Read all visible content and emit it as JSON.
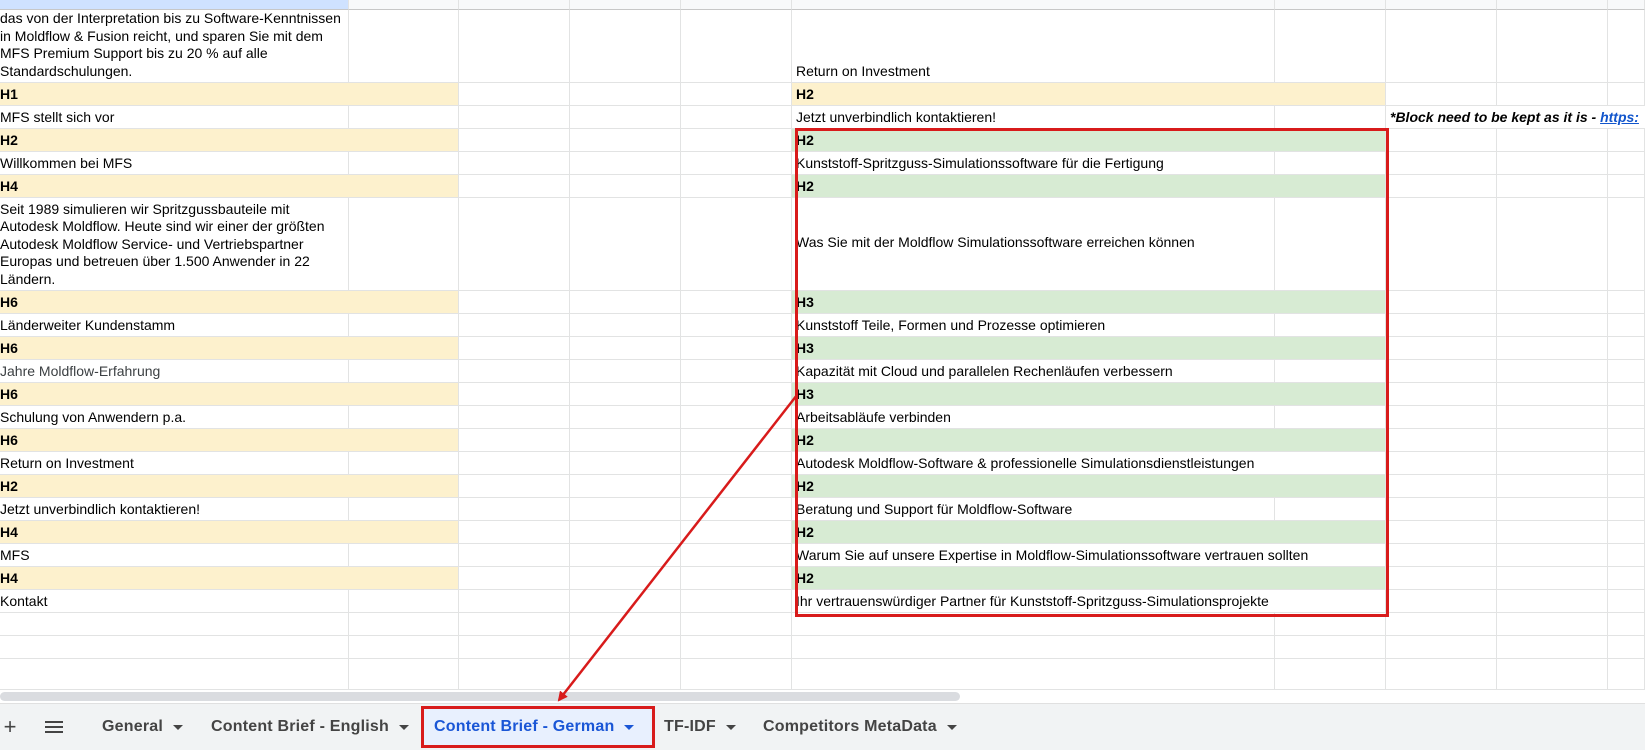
{
  "left_column": {
    "intro_text": "das von der Interpretation bis zu Software-Kenntnissen in Moldflow & Fusion reicht, und sparen Sie mit dem MFS Premium Support bis zu 20 % auf alle Standardschulungen.",
    "rows": [
      {
        "tag": "H1",
        "text": "MFS stellt sich vor"
      },
      {
        "tag": "H2",
        "text": "Willkommen bei MFS"
      },
      {
        "tag": "H4",
        "text": "Seit 1989 simulieren wir Spritzgussbauteile mit Autodesk Moldflow. Heute sind wir einer der größten Autodesk Moldflow Service- und Vertriebspartner Europas und betreuen über 1.500 Anwender in 22 Ländern."
      },
      {
        "tag": "H6",
        "text": "Länderweiter Kundenstamm"
      },
      {
        "tag": "H6",
        "text": "Jahre Moldflow-Erfahrung"
      },
      {
        "tag": "H6",
        "text": "Schulung von Anwendern p.a."
      },
      {
        "tag": "H6",
        "text": "Return on Investment"
      },
      {
        "tag": "H2",
        "text": "Jetzt unverbindlich kontaktieren!"
      },
      {
        "tag": "H4",
        "text": "MFS"
      },
      {
        "tag": "H4",
        "text": "Kontakt"
      }
    ]
  },
  "right_column": {
    "top_text": "Return on Investment",
    "h2_plain": "H2",
    "contact_text": "Jetzt unverbindlich kontaktieren!",
    "note_text": "*Block need to be kept as it is - ",
    "note_link": "https:",
    "rows": [
      {
        "tag": "H2",
        "text": "Kunststoff-Spritzguss-Simulationssoftware für die Fertigung"
      },
      {
        "tag": "H2",
        "text": "Was Sie mit der Moldflow Simulationssoftware erreichen können"
      },
      {
        "tag": "H3",
        "text": "Kunststoff Teile, Formen und Prozesse optimieren"
      },
      {
        "tag": "H3",
        "text": "Kapazität mit Cloud und parallelen Rechenläufen verbessern"
      },
      {
        "tag": "H3",
        "text": "Arbeitsabläufe verbinden"
      },
      {
        "tag": "H2",
        "text": "Autodesk Moldflow-Software & professionelle Simulationsdienstleistungen"
      },
      {
        "tag": "H2",
        "text": "Beratung und Support für Moldflow-Software"
      },
      {
        "tag": "H2",
        "text": "Warum Sie auf unsere Expertise in Moldflow-Simulationssoftware vertrauen sollten"
      },
      {
        "tag": "H2",
        "text": "Ihr vertrauenswürdiger Partner für Kunststoff-Spritzguss-Simulationsprojekte"
      }
    ]
  },
  "sheet_tabs": {
    "add_icon": "plus-icon",
    "list_icon": "all-sheets-icon",
    "tabs": [
      {
        "label": "General",
        "active": false
      },
      {
        "label": "Content Brief - English",
        "active": false
      },
      {
        "label": "Content Brief - German",
        "active": true
      },
      {
        "label": "TF-IDF",
        "active": false
      },
      {
        "label": "Competitors MetaData",
        "active": false
      }
    ]
  },
  "colors": {
    "header_yellow": "#fdf1cd",
    "header_green": "#d7ebd3",
    "annotation_red": "#d81b1b",
    "active_tab_blue": "#1a56d6"
  }
}
